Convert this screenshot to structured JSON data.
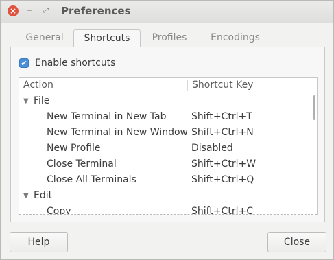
{
  "window": {
    "title": "Preferences"
  },
  "titlebar": {
    "close_glyph": "×",
    "minimize_glyph": "–",
    "maximize_glyph": "⤢"
  },
  "tabs": [
    {
      "label": "General",
      "active": false
    },
    {
      "label": "Shortcuts",
      "active": true
    },
    {
      "label": "Profiles",
      "active": false
    },
    {
      "label": "Encodings",
      "active": false
    }
  ],
  "enable_shortcuts": {
    "label": "Enable shortcuts",
    "checked": true,
    "check_glyph": "✔"
  },
  "table": {
    "columns": [
      "Action",
      "Shortcut Key"
    ],
    "expander_glyph": "▼",
    "rows": [
      {
        "type": "group",
        "action": "File",
        "key": ""
      },
      {
        "type": "item",
        "action": "New Terminal in New Tab",
        "key": "Shift+Ctrl+T"
      },
      {
        "type": "item",
        "action": "New Terminal in New Window",
        "key": "Shift+Ctrl+N"
      },
      {
        "type": "item",
        "action": "New Profile",
        "key": "Disabled"
      },
      {
        "type": "item",
        "action": "Close Terminal",
        "key": "Shift+Ctrl+W"
      },
      {
        "type": "item",
        "action": "Close All Terminals",
        "key": "Shift+Ctrl+Q"
      },
      {
        "type": "group",
        "action": "Edit",
        "key": ""
      },
      {
        "type": "item",
        "action": "Copy",
        "key": "Shift+Ctrl+C"
      }
    ]
  },
  "buttons": {
    "help": "Help",
    "close": "Close"
  },
  "colors": {
    "checkbox": "#4a90d9",
    "close_button": "#e0533f"
  }
}
